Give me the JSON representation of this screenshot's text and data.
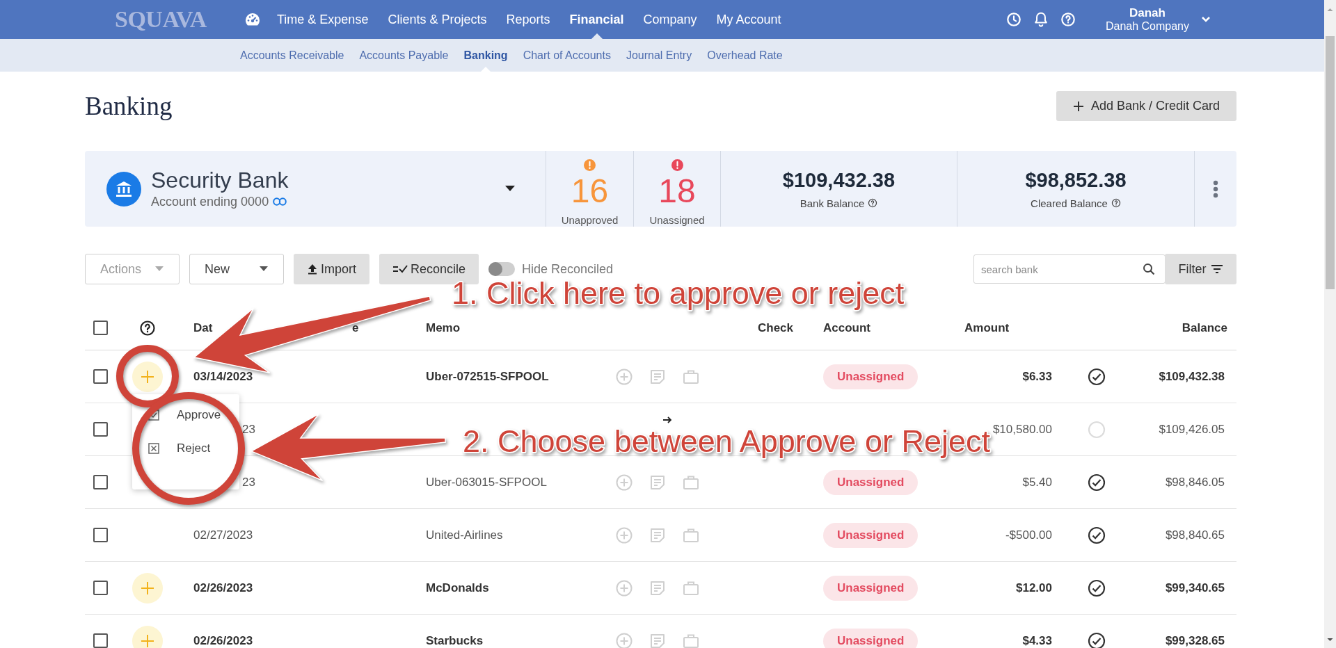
{
  "header": {
    "logo": "SQUAVA",
    "nav": [
      {
        "label": "Time & Expense",
        "selected": false
      },
      {
        "label": "Clients & Projects",
        "selected": false
      },
      {
        "label": "Reports",
        "selected": false
      },
      {
        "label": "Financial",
        "selected": true
      },
      {
        "label": "Company",
        "selected": false
      },
      {
        "label": "My Account",
        "selected": false
      }
    ],
    "user": {
      "name": "Danah",
      "company": "Danah Company"
    }
  },
  "subnav": [
    {
      "label": "Accounts Receivable",
      "selected": false
    },
    {
      "label": "Accounts Payable",
      "selected": false
    },
    {
      "label": "Banking",
      "selected": true
    },
    {
      "label": "Chart of Accounts",
      "selected": false
    },
    {
      "label": "Journal Entry",
      "selected": false
    },
    {
      "label": "Overhead Rate",
      "selected": false
    }
  ],
  "page_title": "Banking",
  "add_button": "Add Bank / Credit Card",
  "bank": {
    "name": "Security Bank",
    "account": "Account ending 0000",
    "stats": [
      {
        "value": "16",
        "label": "Unapproved",
        "kind": "warning"
      },
      {
        "value": "18",
        "label": "Unassigned",
        "kind": "error"
      }
    ],
    "balances": [
      {
        "amount": "$109,432.38",
        "label": "Bank Balance"
      },
      {
        "amount": "$98,852.38",
        "label": "Cleared Balance"
      }
    ]
  },
  "toolbar": {
    "actions": {
      "label": "Actions",
      "disabled": true
    },
    "new": "New",
    "import": "Import",
    "reconcile": "Reconcile",
    "hide_reconciled": {
      "label": "Hide Reconciled",
      "on": false
    },
    "search": {
      "placeholder": "search bank"
    },
    "filter": "Filter"
  },
  "table": {
    "select_all_checked": false,
    "columns": [
      "Dat",
      "e",
      "Memo",
      "Check",
      "Account",
      "Amount",
      "Balance"
    ],
    "rows": [
      {
        "kind": "expense",
        "date": "03/14/2023",
        "date_partial": false,
        "checked": false,
        "memo": "Uber-072515-SFPOOL",
        "account": "Unassigned",
        "amount": "$6.33",
        "balance": "$109,432.38",
        "unapproved": true,
        "cleared": true
      },
      {
        "kind": "transfer",
        "date": "23",
        "date_partial": true,
        "checked": false,
        "amount": "$10,580.00",
        "balance": "$109,426.05",
        "unapproved": false,
        "cleared": false
      },
      {
        "kind": "expense",
        "date": "23",
        "date_partial": true,
        "checked": false,
        "memo": "Uber-063015-SFPOOL",
        "account": "Unassigned",
        "amount": "$5.40",
        "balance": "$98,846.05",
        "unapproved": false,
        "cleared": true
      },
      {
        "kind": "expense",
        "date": "02/27/2023",
        "date_partial": false,
        "checked": false,
        "memo": "United-Airlines",
        "account": "Unassigned",
        "amount": "-$500.00",
        "balance": "$98,840.65",
        "unapproved": false,
        "cleared": true
      },
      {
        "kind": "expense",
        "date": "02/26/2023",
        "date_partial": false,
        "checked": false,
        "memo": "McDonalds",
        "account": "Unassigned",
        "amount": "$12.00",
        "balance": "$99,340.65",
        "unapproved": true,
        "cleared": true
      },
      {
        "kind": "expense",
        "date": "02/26/2023",
        "date_partial": false,
        "checked": false,
        "memo": "Starbucks",
        "account": "Unassigned",
        "amount": "$4.33",
        "balance": "$99,328.65",
        "unapproved": true,
        "cleared": true
      }
    ]
  },
  "row_menu": {
    "items": [
      {
        "label": "Approve",
        "kind": "approve"
      },
      {
        "label": "Reject",
        "kind": "reject"
      }
    ]
  },
  "annotations": [
    {
      "text": "1. Click here to approve or reject"
    },
    {
      "text": "2. Choose between Approve or Reject"
    }
  ]
}
